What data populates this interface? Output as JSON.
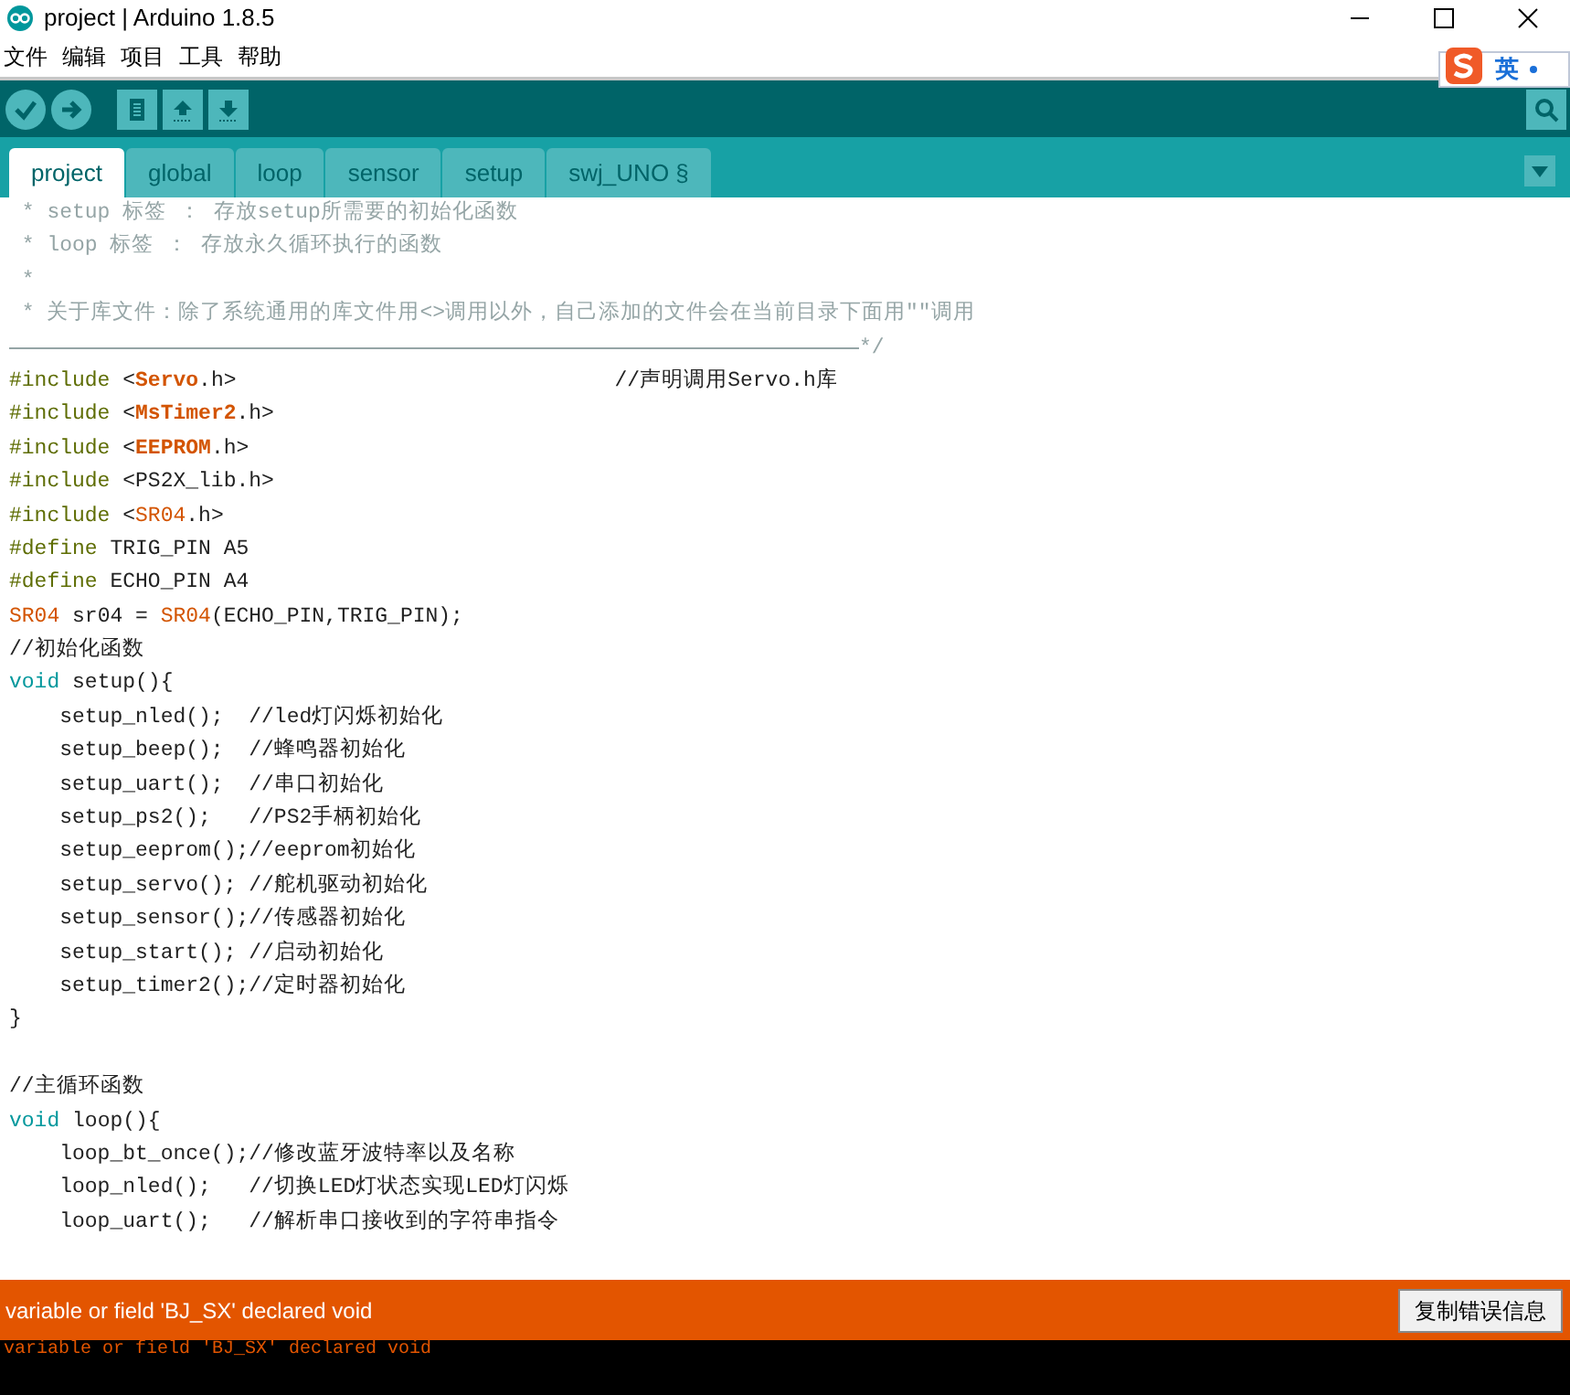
{
  "window": {
    "title": "project | Arduino 1.8.5"
  },
  "menu": [
    "文件",
    "编辑",
    "项目",
    "工具",
    "帮助"
  ],
  "ime": {
    "label": "英"
  },
  "tabs": [
    {
      "label": "project",
      "selected": true
    },
    {
      "label": "global",
      "selected": false
    },
    {
      "label": "loop",
      "selected": false
    },
    {
      "label": "sensor",
      "selected": false
    },
    {
      "label": "setup",
      "selected": false
    },
    {
      "label": "swj_UNO §",
      "selected": false
    }
  ],
  "code": [
    {
      "segs": [
        {
          "kind": "comment",
          "text": " * setup 标签 ： 存放setup所需要的初始化函数"
        }
      ]
    },
    {
      "segs": [
        {
          "kind": "comment",
          "text": " * loop 标签 ： 存放永久循环执行的函数"
        }
      ]
    },
    {
      "segs": [
        {
          "kind": "comment",
          "text": " *"
        }
      ]
    },
    {
      "segs": [
        {
          "kind": "comment",
          "text": " * 关于库文件：除了系统通用的库文件用<>调用以外，自己添加的文件会在当前目录下面用\"\"调用"
        }
      ]
    },
    {
      "segs": [
        {
          "kind": "rule",
          "text": "*/"
        }
      ]
    },
    {
      "segs": [
        {
          "kind": "preproc",
          "text": "#include "
        },
        {
          "kind": "plain",
          "text": "<"
        },
        {
          "kind": "lib",
          "text": "Servo"
        },
        {
          "kind": "plain",
          "text": ".h>                              //声明调用Servo.h库"
        }
      ]
    },
    {
      "segs": [
        {
          "kind": "preproc",
          "text": "#include "
        },
        {
          "kind": "plain",
          "text": "<"
        },
        {
          "kind": "lib",
          "text": "MsTimer2"
        },
        {
          "kind": "plain",
          "text": ".h>"
        }
      ]
    },
    {
      "segs": [
        {
          "kind": "preproc",
          "text": "#include "
        },
        {
          "kind": "plain",
          "text": "<"
        },
        {
          "kind": "lib",
          "text": "EEPROM"
        },
        {
          "kind": "plain",
          "text": ".h>"
        }
      ]
    },
    {
      "segs": [
        {
          "kind": "preproc",
          "text": "#include "
        },
        {
          "kind": "plain",
          "text": "<PS2X_lib.h>"
        }
      ]
    },
    {
      "segs": [
        {
          "kind": "preproc",
          "text": "#include "
        },
        {
          "kind": "plain",
          "text": "<"
        },
        {
          "kind": "class",
          "text": "SR04"
        },
        {
          "kind": "plain",
          "text": ".h>"
        }
      ]
    },
    {
      "segs": [
        {
          "kind": "preproc",
          "text": "#define "
        },
        {
          "kind": "plain",
          "text": "TRIG_PIN A5"
        }
      ]
    },
    {
      "segs": [
        {
          "kind": "preproc",
          "text": "#define "
        },
        {
          "kind": "plain",
          "text": "ECHO_PIN A4"
        }
      ]
    },
    {
      "segs": [
        {
          "kind": "class",
          "text": "SR04"
        },
        {
          "kind": "plain",
          "text": " sr04 = "
        },
        {
          "kind": "class",
          "text": "SR04"
        },
        {
          "kind": "plain",
          "text": "(ECHO_PIN,TRIG_PIN);"
        }
      ]
    },
    {
      "segs": [
        {
          "kind": "plain",
          "text": "//初始化函数"
        }
      ]
    },
    {
      "segs": [
        {
          "kind": "keyword",
          "text": "void "
        },
        {
          "kind": "plain",
          "text": "setup(){"
        }
      ]
    },
    {
      "segs": [
        {
          "kind": "plain",
          "text": "    setup_nled();  //led灯闪烁初始化"
        }
      ]
    },
    {
      "segs": [
        {
          "kind": "plain",
          "text": "    setup_beep();  //蜂鸣器初始化"
        }
      ]
    },
    {
      "segs": [
        {
          "kind": "plain",
          "text": "    setup_uart();  //串口初始化"
        }
      ]
    },
    {
      "segs": [
        {
          "kind": "plain",
          "text": "    setup_ps2();   //PS2手柄初始化"
        }
      ]
    },
    {
      "segs": [
        {
          "kind": "plain",
          "text": "    setup_eeprom();//eeprom初始化"
        }
      ]
    },
    {
      "segs": [
        {
          "kind": "plain",
          "text": "    setup_servo(); //舵机驱动初始化"
        }
      ]
    },
    {
      "segs": [
        {
          "kind": "plain",
          "text": "    setup_sensor();//传感器初始化"
        }
      ]
    },
    {
      "segs": [
        {
          "kind": "plain",
          "text": "    setup_start(); //启动初始化"
        }
      ]
    },
    {
      "segs": [
        {
          "kind": "plain",
          "text": "    setup_timer2();//定时器初始化"
        }
      ]
    },
    {
      "segs": [
        {
          "kind": "plain",
          "text": "}"
        }
      ],
      "space_after": true
    },
    {
      "segs": [
        {
          "kind": "plain",
          "text": "//主循环函数"
        }
      ]
    },
    {
      "segs": [
        {
          "kind": "keyword",
          "text": "void "
        },
        {
          "kind": "plain",
          "text": "loop(){"
        }
      ]
    },
    {
      "segs": [
        {
          "kind": "plain",
          "text": "    loop_bt_once();//修改蓝牙波特率以及名称"
        }
      ]
    },
    {
      "segs": [
        {
          "kind": "plain",
          "text": "    loop_nled();   //切换LED灯状态实现LED灯闪烁"
        }
      ]
    },
    {
      "segs": [
        {
          "kind": "plain",
          "text": "    loop_uart();   //解析串口接收到的字符串指令"
        }
      ]
    }
  ],
  "status": {
    "message": "variable or field 'BJ_SX' declared void",
    "button": "复制错误信息"
  },
  "console": [
    "variable or field 'BJ_SX' declared void"
  ]
}
